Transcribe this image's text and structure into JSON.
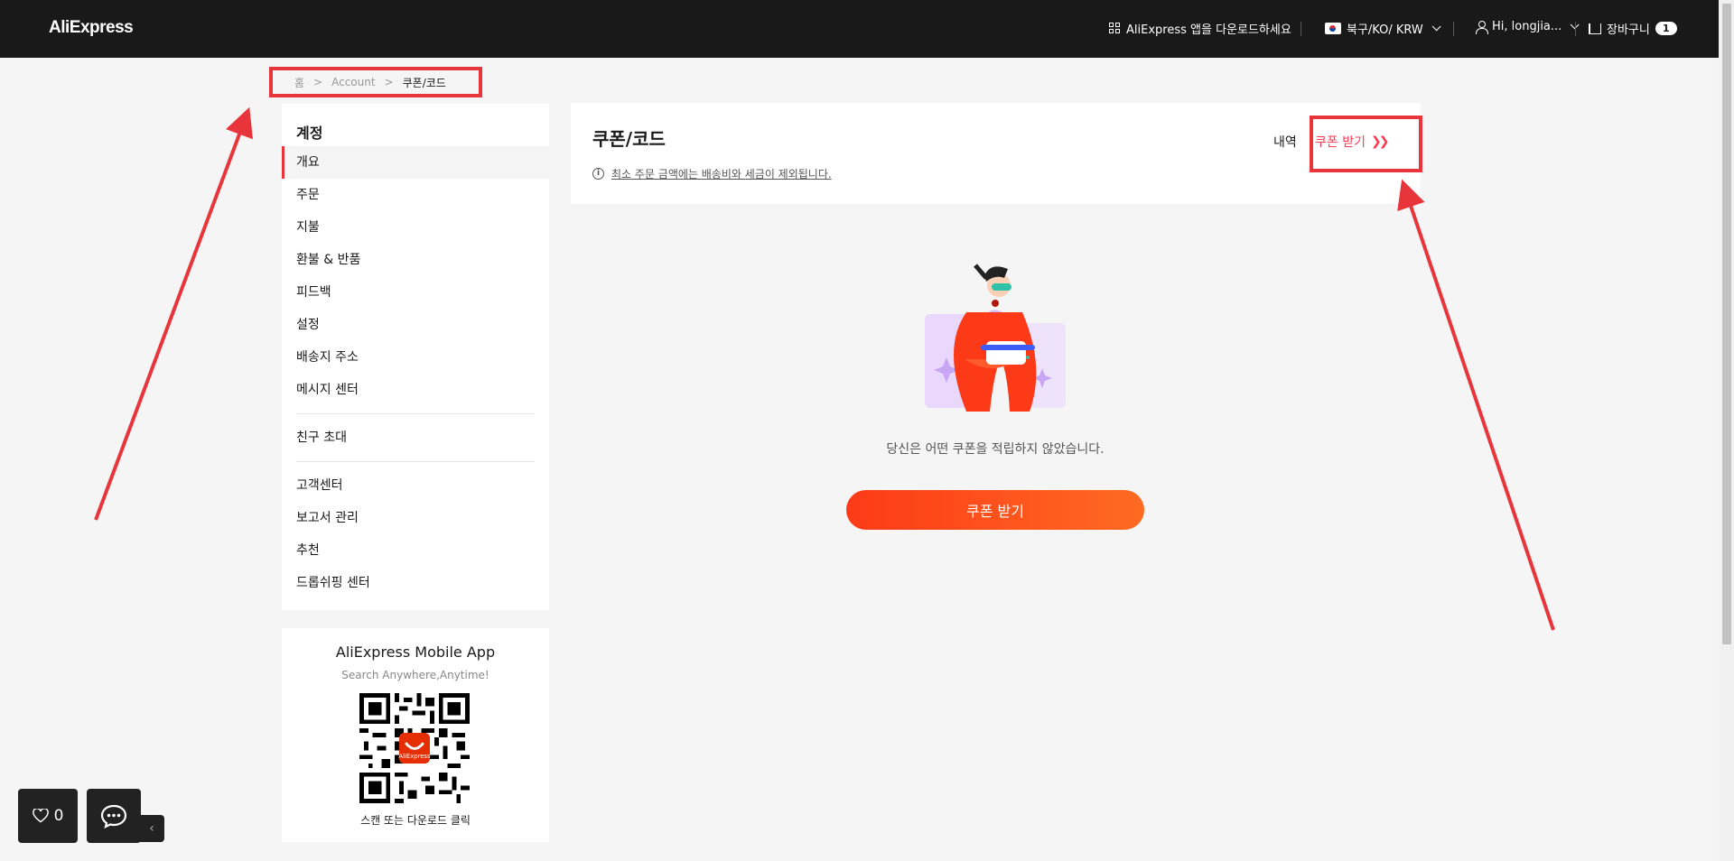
{
  "header": {
    "logo": "AliExpress",
    "app_download": "AliExpress 앱을 다운로드하세요",
    "region": "북구/KO/ KRW",
    "user": "Hi, longjia...",
    "cart_label": "장바구니",
    "cart_count": "1"
  },
  "breadcrumb": {
    "home": "홈",
    "sep1": ">",
    "account": "Account",
    "sep2": ">",
    "current": "쿠폰/코드"
  },
  "sidebar": {
    "title": "계정",
    "items": [
      {
        "label": "개요"
      },
      {
        "label": "주문"
      },
      {
        "label": "지불"
      },
      {
        "label": "환불 & 반품"
      },
      {
        "label": "피드백"
      },
      {
        "label": "설정"
      },
      {
        "label": "배송지 주소"
      },
      {
        "label": "메시지 센터"
      },
      {
        "label": "친구 초대"
      },
      {
        "label": "고객센터"
      },
      {
        "label": "보고서 관리"
      },
      {
        "label": "추천"
      },
      {
        "label": "드롭쉬핑 센터"
      }
    ]
  },
  "app_promo": {
    "title": "AliExpress Mobile App",
    "subtitle": "Search Anywhere,Anytime!",
    "footer": "스캔 또는 다운로드 클릭",
    "qr_logo": "AliExpress"
  },
  "main": {
    "title": "쿠폰/코드",
    "notice": "최소 주문 금액에는 배송비와 세금이 제외됩니다.",
    "history_label": "내역",
    "get_coupon_link": "쿠폰 받기",
    "empty_text": "당신은 어떤 쿠폰을 적립하지 않았습니다.",
    "cta_label": "쿠폰 받기"
  },
  "floating": {
    "wishlist_count": "0"
  },
  "colors": {
    "brand_red": "#fd384f",
    "annotation_red": "#e8353b",
    "header_bg": "#191919",
    "cta_start": "#fd3a17",
    "cta_end": "#fe6a22"
  },
  "icons": [
    "grid-icon",
    "flag-kr-icon",
    "chevron-down-icon",
    "user-icon",
    "cart-icon",
    "info-icon",
    "chevron-right-icon",
    "heart-icon",
    "chat-icon",
    "chevron-left-icon"
  ]
}
